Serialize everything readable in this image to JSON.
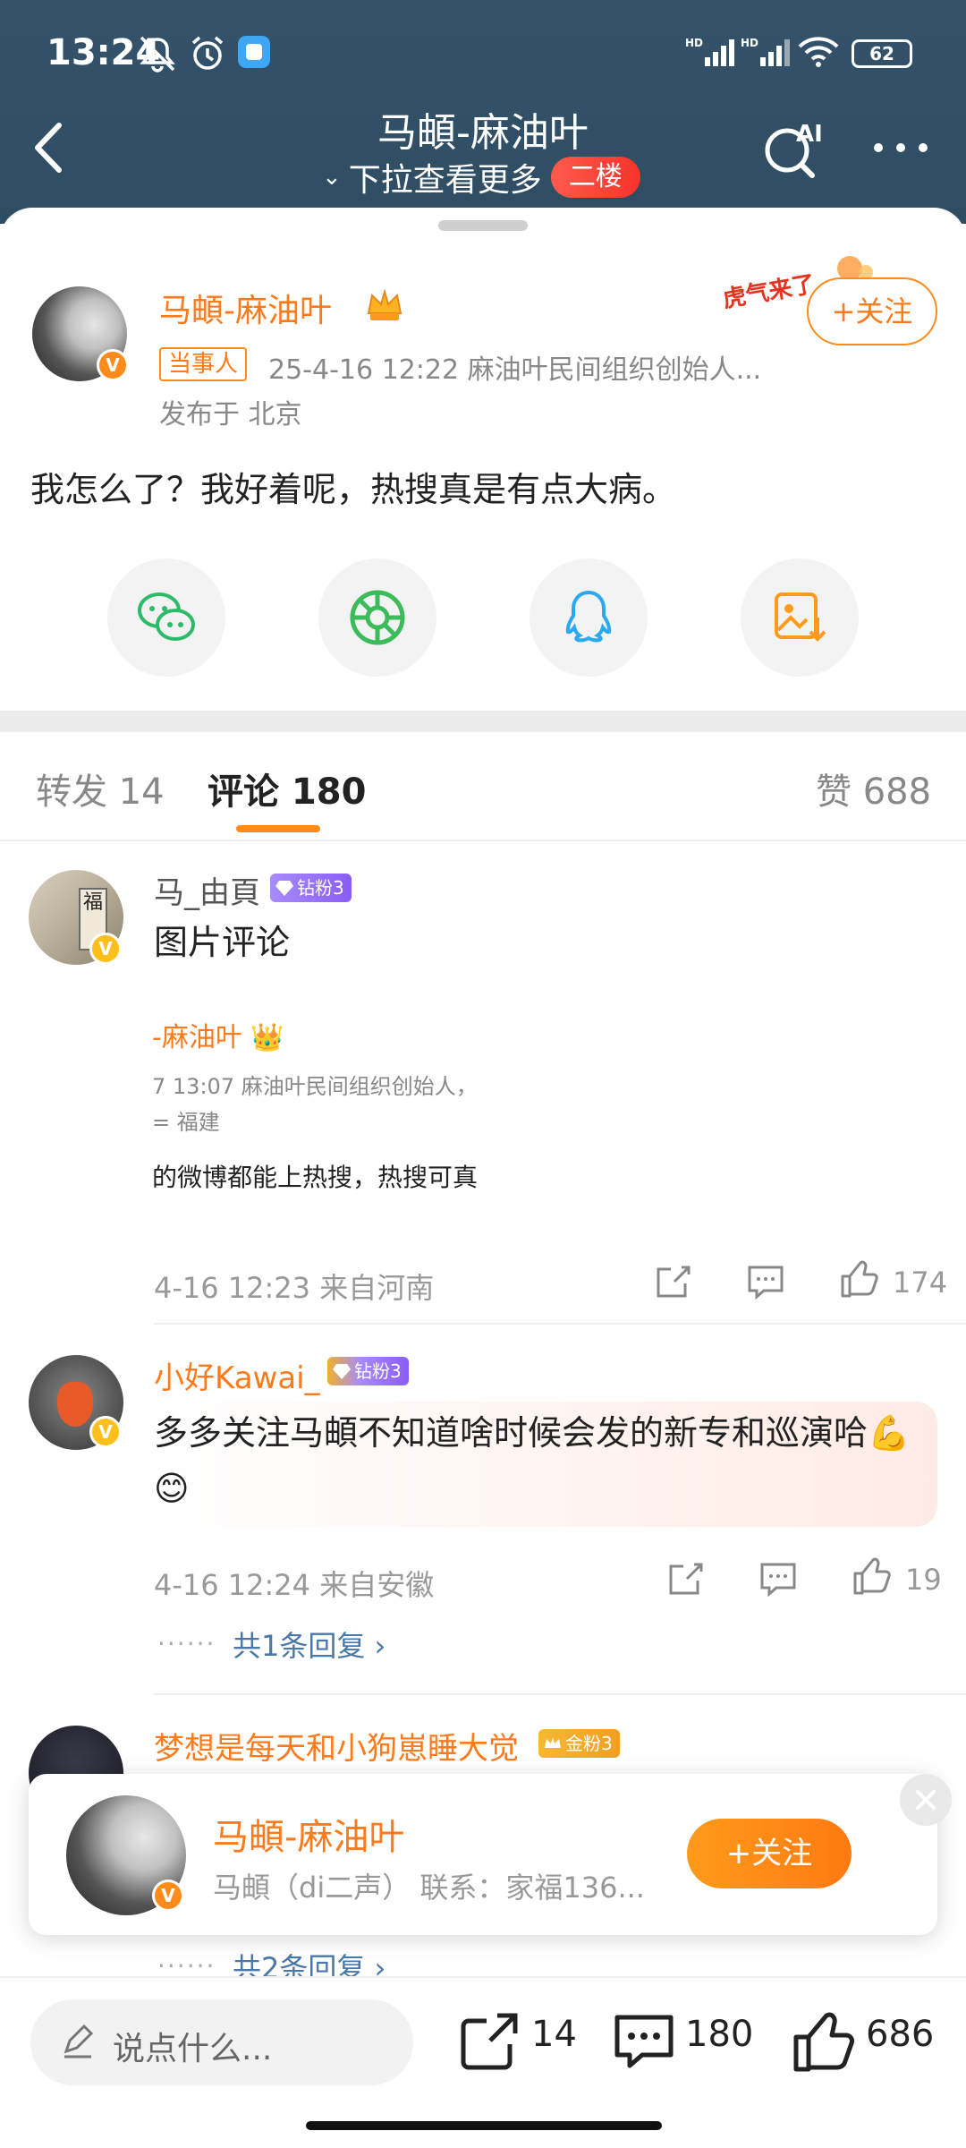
{
  "status_bar": {
    "time": "13:24",
    "battery": "62"
  },
  "nav": {
    "title": "马頔-麻油叶",
    "subtitle": "下拉查看更多",
    "floor_badge": "二楼"
  },
  "post": {
    "author": "马頔-麻油叶",
    "role": "当事人",
    "meta": "25-4-16 12:22  麻油叶民间组织创始人...",
    "location": "发布于 北京",
    "text": "我怎么了？我好着呢，热搜真是有点大病。",
    "follow": "+关注",
    "sticker": "虎气来了"
  },
  "tabs": {
    "repost": "转发 14",
    "comments": "评论 180",
    "likes": "赞 688"
  },
  "comments": [
    {
      "name": "马_由頁",
      "badge": "钻粉3",
      "text": "图片评论",
      "quote": {
        "line1": "-麻油叶",
        "line2": "7 13:07   麻油叶民间组织创始人，",
        "line3": "= 福建",
        "line4": "的微博都能上热搜，热搜可真"
      },
      "time_loc": "4-16 12:23  来自河南",
      "likes": "174"
    },
    {
      "name": "小好Kawai_",
      "badge": "钻粉3",
      "text": "多多关注马頔不知道啥时候会发的新专和巡演哈💪😊",
      "time_loc": "4-16 12:24  来自安徽",
      "likes": "19",
      "replies": "共1条回复 ›"
    },
    {
      "name": "梦想是每天和小狗崽睡大觉",
      "badge": "金粉3",
      "replies": "共2条回复 ›"
    }
  ],
  "float_card": {
    "name": "马頔-麻油叶",
    "desc": "马頔（di二声）  联系：家福136...",
    "follow": "+关注"
  },
  "bottom_bar": {
    "placeholder": "说点什么...",
    "reposts": "14",
    "comments": "180",
    "likes": "686"
  },
  "colors": {
    "header": "#34536b",
    "accent": "#ff8c1a",
    "link": "#4a78a8"
  }
}
